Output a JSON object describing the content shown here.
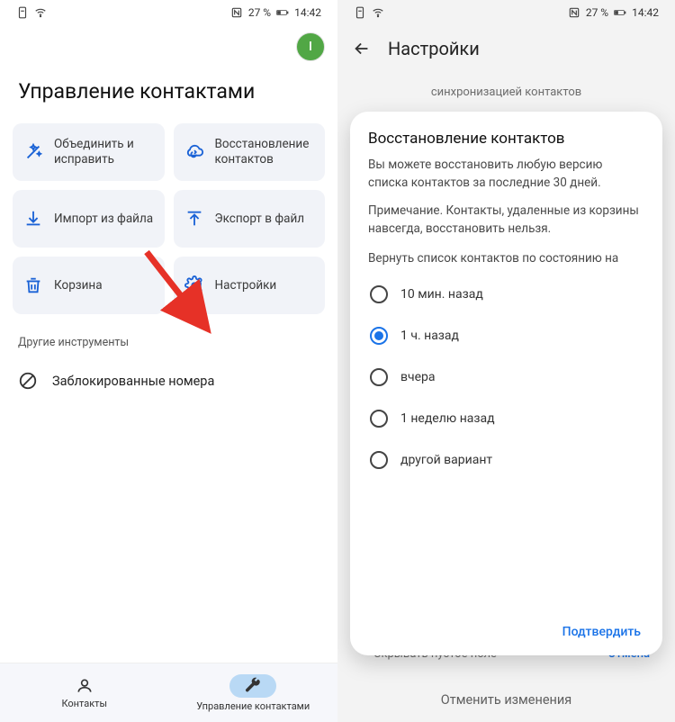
{
  "status": {
    "battery_text": "27 %",
    "time": "14:42"
  },
  "left": {
    "avatar_letter": "I",
    "title": "Управление контактами",
    "tiles": [
      {
        "label": "Объединить и исправить"
      },
      {
        "label": "Восстановление контактов"
      },
      {
        "label": "Импорт из файла"
      },
      {
        "label": "Экспорт в файл"
      },
      {
        "label": "Корзина"
      },
      {
        "label": "Настройки"
      }
    ],
    "section": "Другие инструменты",
    "blocked": "Заблокированные номера",
    "nav": {
      "contacts": "Контакты",
      "manage": "Управление контактами"
    }
  },
  "right": {
    "title": "Настройки",
    "bg_top_line2": "синхронизацией контактов",
    "bg_bottom_text": "Скрывать пустое поле",
    "bg_bottom_cancel": "Отмена",
    "undo": "Отменить изменения",
    "dialog": {
      "title": "Восстановление контактов",
      "body": "Вы можете восстановить любую версию списка контактов за последние 30 дней.",
      "note": "Примечание. Контакты, удаленные из корзины навсегда, восстановить нельзя.",
      "sub": "Вернуть список контактов по состоянию на",
      "options": [
        {
          "label": "10 мин. назад",
          "selected": false
        },
        {
          "label": "1 ч. назад",
          "selected": true
        },
        {
          "label": "вчера",
          "selected": false
        },
        {
          "label": "1 неделю назад",
          "selected": false
        },
        {
          "label": "другой вариант",
          "selected": false
        }
      ],
      "confirm": "Подтвердить"
    }
  }
}
